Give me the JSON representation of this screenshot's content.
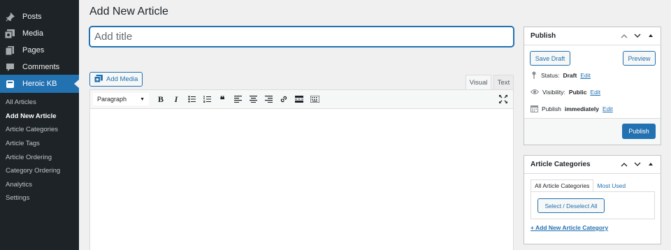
{
  "sidebar": {
    "items": [
      {
        "label": "Posts",
        "icon": "pin-icon"
      },
      {
        "label": "Media",
        "icon": "media-icon"
      },
      {
        "label": "Pages",
        "icon": "pages-icon"
      },
      {
        "label": "Comments",
        "icon": "comments-icon"
      },
      {
        "label": "Heroic KB",
        "icon": "kb-icon"
      }
    ],
    "submenu": [
      "All Articles",
      "Add New Article",
      "Article Categories",
      "Article Tags",
      "Article Ordering",
      "Category Ordering",
      "Analytics",
      "Settings"
    ]
  },
  "page": {
    "title": "Add New Article",
    "title_placeholder": "Add title"
  },
  "editor": {
    "add_media_label": "Add Media",
    "tab_visual": "Visual",
    "tab_text": "Text",
    "format_value": "Paragraph"
  },
  "publish": {
    "heading": "Publish",
    "save_draft": "Save Draft",
    "preview": "Preview",
    "status_label": "Status:",
    "status_value": "Draft",
    "visibility_label": "Visibility:",
    "visibility_value": "Public",
    "publish_label": "Publish",
    "publish_value": "immediately",
    "edit_link": "Edit",
    "publish_button": "Publish"
  },
  "categories": {
    "heading": "Article Categories",
    "tab_all": "All Article Categories",
    "tab_most_used": "Most Used",
    "select_all": "Select / Deselect All",
    "add_new": "+ Add New Article Category"
  },
  "colors": {
    "sidebar_bg": "#1d2327",
    "accent": "#2271b1",
    "page_bg": "#f0f0f1"
  }
}
